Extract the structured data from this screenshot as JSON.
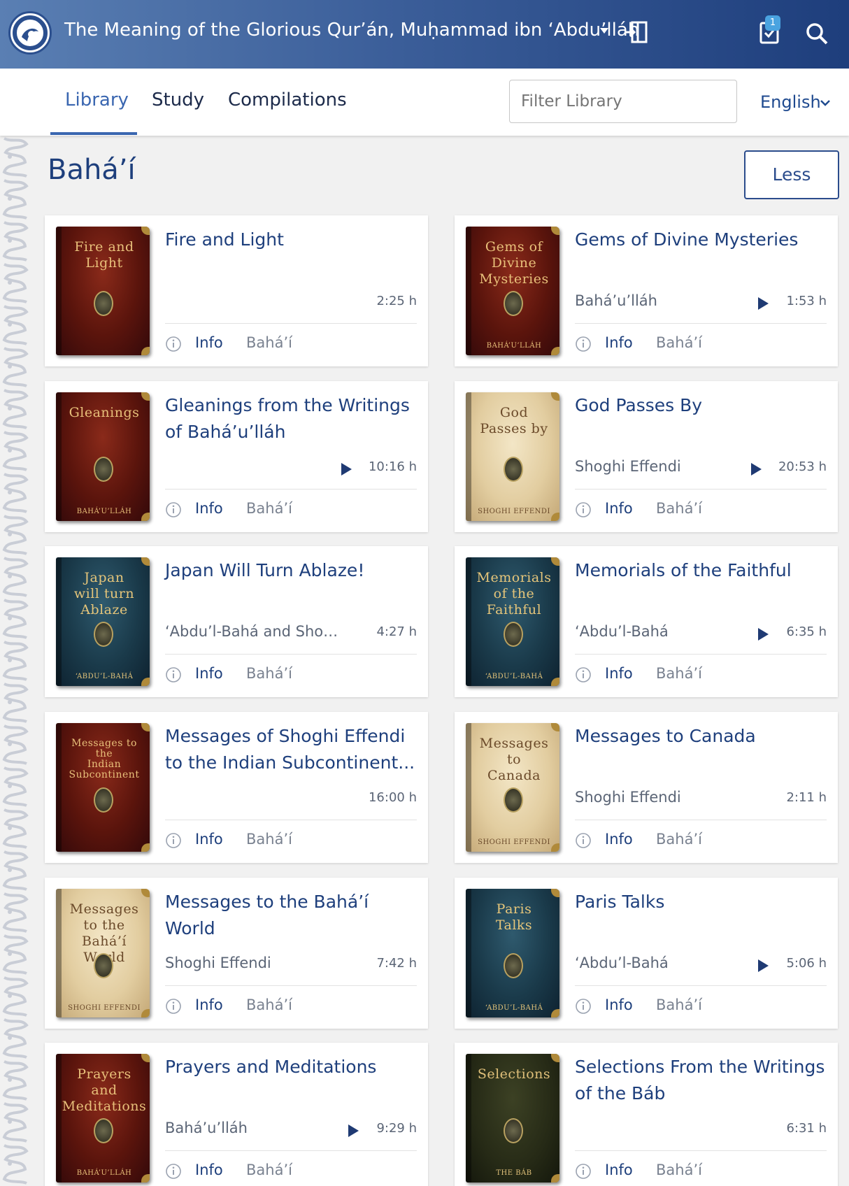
{
  "app": {
    "title": "The Meaning of the Glorious Qur’án, Muḥammad ibn ‘Abdu’lláh",
    "task_badge": "1"
  },
  "nav": {
    "tabs": [
      {
        "label": "Library",
        "active": true
      },
      {
        "label": "Study",
        "active": false
      },
      {
        "label": "Compilations",
        "active": false
      }
    ],
    "filter_placeholder": "Filter Library",
    "language": "English"
  },
  "section": {
    "title": "Bahá’í",
    "toggle_label": "Less"
  },
  "card_labels": {
    "info": "Info"
  },
  "books": [
    {
      "title": "Fire and Light",
      "author": "",
      "duration": "2:25 h",
      "playable": false,
      "category": "Bahá’í",
      "cover": {
        "style": "red",
        "title_lines": [
          "Fire and",
          "Light"
        ],
        "author": ""
      }
    },
    {
      "title": "Gems of Divine Mysteries",
      "author": "Bahá’u’lláh",
      "duration": "1:53 h",
      "playable": true,
      "category": "Bahá’í",
      "cover": {
        "style": "red",
        "title_lines": [
          "Gems of",
          "Divine",
          "Mysteries"
        ],
        "author": "BAHÁ’U’LLÁH"
      }
    },
    {
      "title": "Gleanings from the Writings of Bahá’u’lláh",
      "author": "",
      "duration": "10:16 h",
      "playable": true,
      "category": "Bahá’í",
      "cover": {
        "style": "red",
        "title_lines": [
          "Gleanings"
        ],
        "author": "BAHÁ’U’LLÁH"
      }
    },
    {
      "title": "God Passes By",
      "author": "Shoghi Effendi",
      "duration": "20:53 h",
      "playable": true,
      "category": "Bahá’í",
      "cover": {
        "style": "tan",
        "title_lines": [
          "God",
          "Passes by"
        ],
        "author": "SHOGHI EFFENDI"
      }
    },
    {
      "title": "Japan Will Turn Ablaze!",
      "author": "‘Abdu’l-Bahá and Shogh...",
      "duration": "4:27 h",
      "playable": false,
      "category": "Bahá’í",
      "cover": {
        "style": "blue",
        "title_lines": [
          "Japan",
          "will turn",
          "Ablaze"
        ],
        "author": "‘ABDU’L-BAHÁ"
      }
    },
    {
      "title": "Memorials of the Faithful",
      "author": "‘Abdu’l-Bahá",
      "duration": "6:35 h",
      "playable": true,
      "category": "Bahá’í",
      "cover": {
        "style": "blue",
        "title_lines": [
          "Memorials",
          "of the",
          "Faithful"
        ],
        "author": "‘ABDU’L-BAHÁ"
      }
    },
    {
      "title": "Messages of Shoghi Effendi to the Indian Subcontinent...",
      "author": "",
      "duration": "16:00 h",
      "playable": false,
      "category": "Bahá’í",
      "cover": {
        "style": "red",
        "title_lines": [
          "Messages to the",
          "Indian",
          "Subcontinent"
        ],
        "author": "",
        "small": true
      }
    },
    {
      "title": "Messages to Canada",
      "author": "Shoghi Effendi",
      "duration": "2:11 h",
      "playable": false,
      "category": "Bahá’í",
      "cover": {
        "style": "tan",
        "title_lines": [
          "Messages",
          "to",
          "Canada"
        ],
        "author": "SHOGHI EFFENDI"
      }
    },
    {
      "title": "Messages to the Bahá’í World",
      "author": "Shoghi Effendi",
      "duration": "7:42 h",
      "playable": false,
      "category": "Bahá’í",
      "cover": {
        "style": "tan",
        "title_lines": [
          "Messages",
          "to the",
          "Bahá’í World"
        ],
        "author": "SHOGHI EFFENDI"
      }
    },
    {
      "title": "Paris Talks",
      "author": "‘Abdu’l-Bahá",
      "duration": "5:06 h",
      "playable": true,
      "category": "Bahá’í",
      "cover": {
        "style": "blue",
        "title_lines": [
          "Paris",
          "Talks"
        ],
        "author": "‘ABDU’L-BAHÁ"
      }
    },
    {
      "title": "Prayers and Meditations",
      "author": "Bahá’u’lláh",
      "duration": "9:29 h",
      "playable": true,
      "category": "Bahá’í",
      "cover": {
        "style": "red",
        "title_lines": [
          "Prayers",
          "and",
          "Meditations"
        ],
        "author": "BAHÁ’U’LLÁH"
      }
    },
    {
      "title": "Selections From the Writings of the Báb",
      "author": "",
      "duration": "6:31 h",
      "playable": false,
      "category": "Bahá’í",
      "cover": {
        "style": "olive",
        "title_lines": [
          "Selections"
        ],
        "author": "THE BÁB"
      }
    }
  ]
}
